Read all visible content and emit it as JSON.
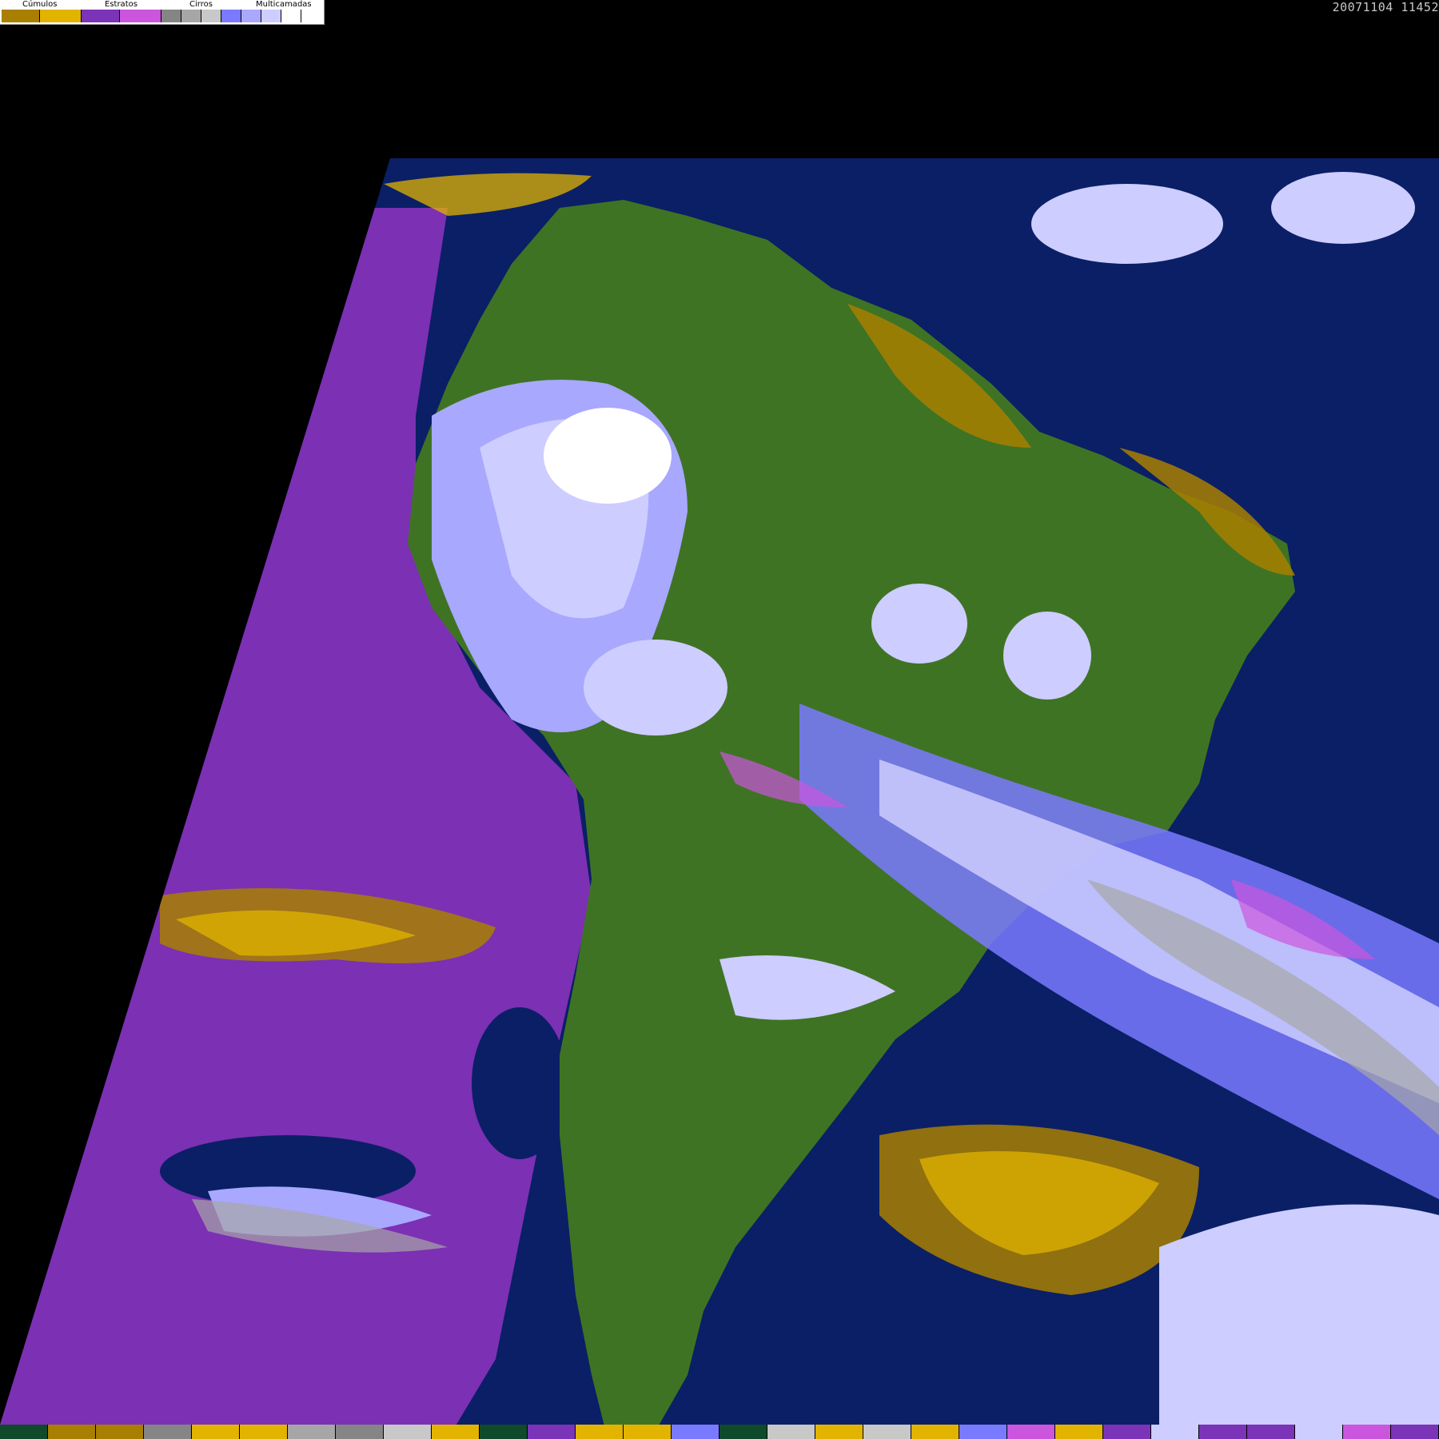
{
  "legend": {
    "categories": [
      {
        "label": "Cúmulos",
        "swatches": [
          "#a87f00",
          "#e2b400"
        ]
      },
      {
        "label": "Estratos",
        "swatches": [
          "#7b33b8",
          "#cc55de"
        ]
      },
      {
        "label": "Cirros",
        "swatches": [
          "#858585",
          "#a6a6a6",
          "#c8c8c8"
        ]
      },
      {
        "label": "Multicamadas",
        "swatches": [
          "#7a7aff",
          "#a8a8ff",
          "#cdcdff",
          "#ffffff"
        ]
      }
    ]
  },
  "timestamp": "20071104 11452",
  "map": {
    "colors": {
      "background": "#000000",
      "ocean": "#0a1f66",
      "pacific_stratus": "#7c30b4",
      "land": "#3f7324",
      "land_dark": "#2f5a1a",
      "cumulus": "#a87f00",
      "cumulus_light": "#e2b400",
      "stratus_pink": "#cc55de",
      "cirrus": "#a6a6a6",
      "multi_blue": "#7a7aff",
      "multi_light": "#cdcdff",
      "multi_white": "#ffffff"
    }
  },
  "bottom_bar": {
    "colors": [
      "#0f4a2c",
      "#a87f00",
      "#a87f00",
      "#858585",
      "#e2b400",
      "#e2b400",
      "#a6a6a6",
      "#858585",
      "#c8c8c8",
      "#e2b400",
      "#0f4a2c",
      "#7b33b8",
      "#e2b400",
      "#e2b400",
      "#7a7aff",
      "#0f4a2c",
      "#c8c8c8",
      "#e2b400",
      "#c8c8c8",
      "#e2b400",
      "#7a7aff",
      "#cc55de",
      "#e2b400",
      "#7b33b8",
      "#cdcdff",
      "#7b33b8",
      "#7b33b8",
      "#cdcdff",
      "#cc55de",
      "#7b33b8"
    ]
  }
}
